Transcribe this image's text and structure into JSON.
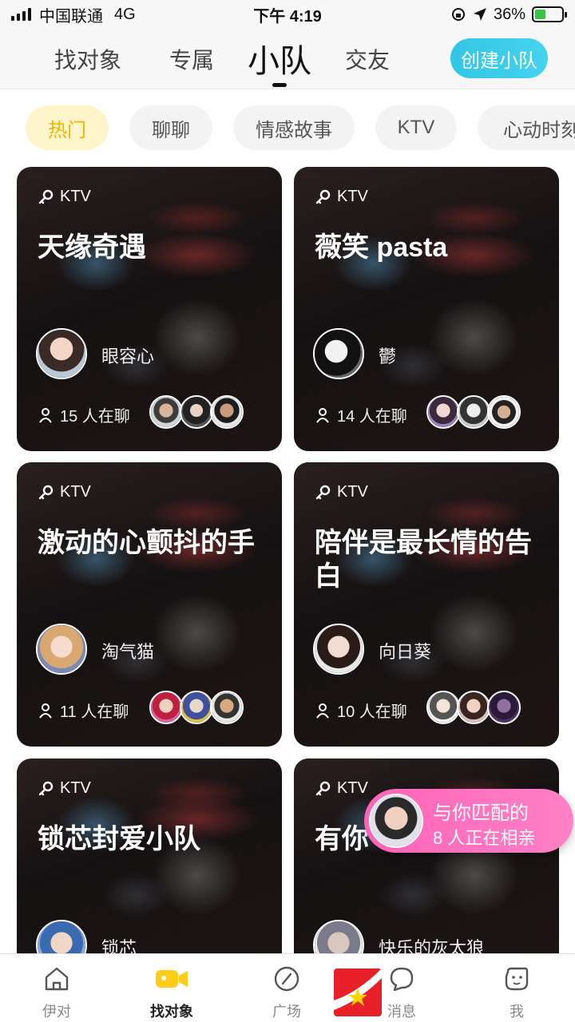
{
  "status_bar": {
    "carrier": "中国联通",
    "network": "4G",
    "time": "下午 4:19",
    "battery": "36%"
  },
  "top_nav": {
    "tabs": [
      "找对象",
      "专属",
      "小队",
      "交友"
    ],
    "active_tab": "小队",
    "create_button": "创建小队"
  },
  "categories": {
    "items": [
      "热门",
      "聊聊",
      "情感故事",
      "KTV",
      "心动时刻"
    ],
    "active": "热门"
  },
  "cards": [
    {
      "category": "KTV",
      "title": "天缘奇遇",
      "owner": "眼容心",
      "chatting": "15 人在聊"
    },
    {
      "category": "KTV",
      "title": "薇笑 pasta",
      "owner": "鬱",
      "chatting": "14 人在聊"
    },
    {
      "category": "KTV",
      "title": "激动的心颤抖的手",
      "owner": "淘气猫",
      "chatting": "11 人在聊"
    },
    {
      "category": "KTV",
      "title": "陪伴是最长情的告白",
      "owner": "向日葵",
      "chatting": "10 人在聊"
    },
    {
      "category": "KTV",
      "title": "锁芯封爱小队",
      "owner": "锁芯",
      "chatting": ""
    },
    {
      "category": "KTV",
      "title": "有你",
      "owner": "快乐的灰太狼",
      "chatting": ""
    }
  ],
  "match_pill": {
    "line1": "与你匹配的",
    "line2": "8 人正在相亲"
  },
  "bottom_nav": {
    "items": [
      "伊对",
      "找对象",
      "广场",
      "消息",
      "我"
    ],
    "active": "找对象"
  },
  "colors": {
    "accent_blue": "#33c6e4",
    "chip_active_bg": "#fff5cc",
    "chip_active_text": "#f1b300",
    "match_pink": "#ff6fbd",
    "tab_active_yellow": "#ffcc1a"
  }
}
